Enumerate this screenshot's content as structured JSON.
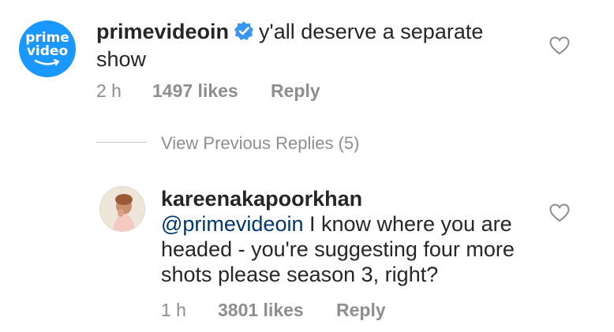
{
  "comment1": {
    "avatar": {
      "line1": "prime",
      "line2": "video",
      "icon": "amazon-smile-logo",
      "color": "#1a98ff"
    },
    "username": "primevideoin",
    "verified_icon": "verified-badge-icon",
    "text": "y'all deserve a separate",
    "text_line2": "show",
    "time": "2 h",
    "likes": "1497 likes",
    "reply": "Reply",
    "like_icon": "heart-outline-icon"
  },
  "view_previous": "View Previous Replies (5)",
  "comment2": {
    "avatar_icon": "profile-photo",
    "username": "kareenakapoorkhan",
    "mention": "@primevideoin",
    "text_line1": " I know where you are",
    "text_line2": "headed - you're suggesting four more",
    "text_line3": "shots please season 3, right?",
    "time": "1 h",
    "likes": "3801 likes",
    "reply": "Reply",
    "like_icon": "heart-outline-icon"
  },
  "colors": {
    "meta": "#8e8e8e",
    "text": "#262626",
    "mention": "#00376b",
    "verified": "#3897f0"
  }
}
